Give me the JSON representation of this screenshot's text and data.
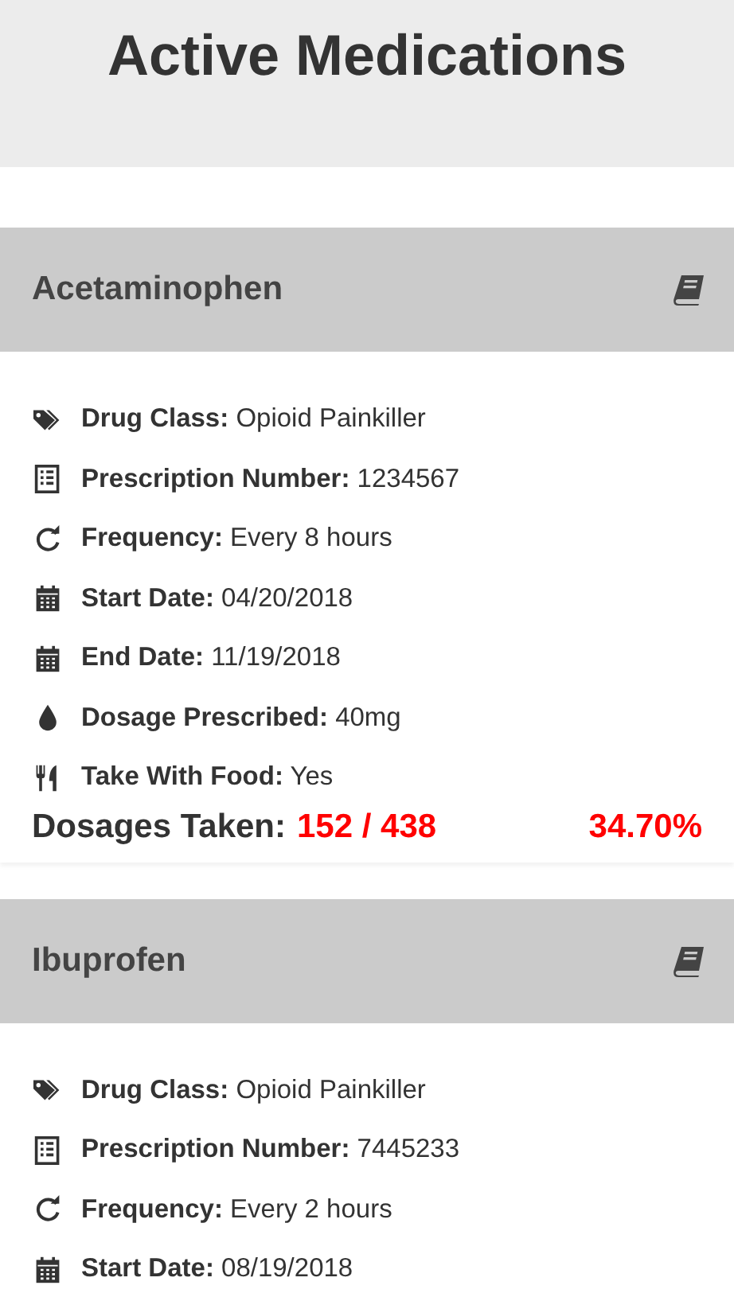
{
  "title": "Active Medications",
  "medications": [
    {
      "name": "Acetaminophen",
      "fields": [
        {
          "kind": "tag",
          "text": "**Drug Class:** Opioid Painkiller"
        },
        {
          "kind": "list",
          "text": "**Prescription Number:** 1234567"
        },
        {
          "kind": "refresh",
          "text": "**Frequency:** Every 8 hours"
        },
        {
          "kind": "calendar",
          "text": "**Start Date:** 04/20/2018"
        },
        {
          "kind": "calendar",
          "text": "**End Date:** 11/19/2018"
        },
        {
          "kind": "drop",
          "text": "**Dosage Prescribed:** 40mg"
        },
        {
          "kind": "utensils",
          "text": "**Take With Food:** Yes"
        }
      ],
      "dosages": {
        "label": "Dosages Taken:",
        "count": "152 / 438",
        "percent": "34.70%"
      }
    },
    {
      "name": "Ibuprofen",
      "fields": [
        {
          "kind": "tag",
          "text": "**Drug Class:** Opioid Painkiller"
        },
        {
          "kind": "list",
          "text": "**Prescription Number:** 7445233"
        },
        {
          "kind": "refresh",
          "text": "**Frequency:** Every 2 hours"
        },
        {
          "kind": "calendar",
          "text": "**Start Date:** 08/19/2018"
        }
      ]
    }
  ]
}
